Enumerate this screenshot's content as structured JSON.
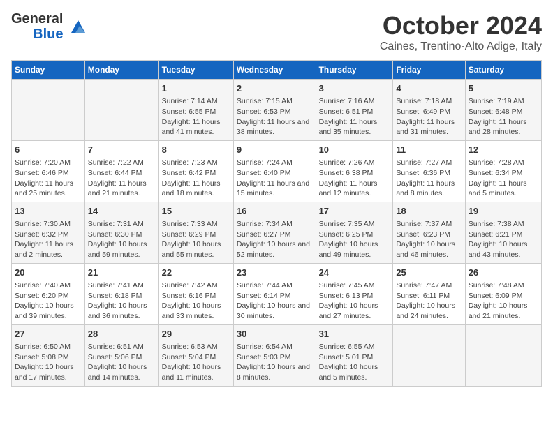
{
  "header": {
    "logo_general": "General",
    "logo_blue": "Blue",
    "month": "October 2024",
    "location": "Caines, Trentino-Alto Adige, Italy"
  },
  "days_of_week": [
    "Sunday",
    "Monday",
    "Tuesday",
    "Wednesday",
    "Thursday",
    "Friday",
    "Saturday"
  ],
  "weeks": [
    [
      {
        "day": "",
        "content": ""
      },
      {
        "day": "",
        "content": ""
      },
      {
        "day": "1",
        "content": "Sunrise: 7:14 AM\nSunset: 6:55 PM\nDaylight: 11 hours and 41 minutes."
      },
      {
        "day": "2",
        "content": "Sunrise: 7:15 AM\nSunset: 6:53 PM\nDaylight: 11 hours and 38 minutes."
      },
      {
        "day": "3",
        "content": "Sunrise: 7:16 AM\nSunset: 6:51 PM\nDaylight: 11 hours and 35 minutes."
      },
      {
        "day": "4",
        "content": "Sunrise: 7:18 AM\nSunset: 6:49 PM\nDaylight: 11 hours and 31 minutes."
      },
      {
        "day": "5",
        "content": "Sunrise: 7:19 AM\nSunset: 6:48 PM\nDaylight: 11 hours and 28 minutes."
      }
    ],
    [
      {
        "day": "6",
        "content": "Sunrise: 7:20 AM\nSunset: 6:46 PM\nDaylight: 11 hours and 25 minutes."
      },
      {
        "day": "7",
        "content": "Sunrise: 7:22 AM\nSunset: 6:44 PM\nDaylight: 11 hours and 21 minutes."
      },
      {
        "day": "8",
        "content": "Sunrise: 7:23 AM\nSunset: 6:42 PM\nDaylight: 11 hours and 18 minutes."
      },
      {
        "day": "9",
        "content": "Sunrise: 7:24 AM\nSunset: 6:40 PM\nDaylight: 11 hours and 15 minutes."
      },
      {
        "day": "10",
        "content": "Sunrise: 7:26 AM\nSunset: 6:38 PM\nDaylight: 11 hours and 12 minutes."
      },
      {
        "day": "11",
        "content": "Sunrise: 7:27 AM\nSunset: 6:36 PM\nDaylight: 11 hours and 8 minutes."
      },
      {
        "day": "12",
        "content": "Sunrise: 7:28 AM\nSunset: 6:34 PM\nDaylight: 11 hours and 5 minutes."
      }
    ],
    [
      {
        "day": "13",
        "content": "Sunrise: 7:30 AM\nSunset: 6:32 PM\nDaylight: 11 hours and 2 minutes."
      },
      {
        "day": "14",
        "content": "Sunrise: 7:31 AM\nSunset: 6:30 PM\nDaylight: 10 hours and 59 minutes."
      },
      {
        "day": "15",
        "content": "Sunrise: 7:33 AM\nSunset: 6:29 PM\nDaylight: 10 hours and 55 minutes."
      },
      {
        "day": "16",
        "content": "Sunrise: 7:34 AM\nSunset: 6:27 PM\nDaylight: 10 hours and 52 minutes."
      },
      {
        "day": "17",
        "content": "Sunrise: 7:35 AM\nSunset: 6:25 PM\nDaylight: 10 hours and 49 minutes."
      },
      {
        "day": "18",
        "content": "Sunrise: 7:37 AM\nSunset: 6:23 PM\nDaylight: 10 hours and 46 minutes."
      },
      {
        "day": "19",
        "content": "Sunrise: 7:38 AM\nSunset: 6:21 PM\nDaylight: 10 hours and 43 minutes."
      }
    ],
    [
      {
        "day": "20",
        "content": "Sunrise: 7:40 AM\nSunset: 6:20 PM\nDaylight: 10 hours and 39 minutes."
      },
      {
        "day": "21",
        "content": "Sunrise: 7:41 AM\nSunset: 6:18 PM\nDaylight: 10 hours and 36 minutes."
      },
      {
        "day": "22",
        "content": "Sunrise: 7:42 AM\nSunset: 6:16 PM\nDaylight: 10 hours and 33 minutes."
      },
      {
        "day": "23",
        "content": "Sunrise: 7:44 AM\nSunset: 6:14 PM\nDaylight: 10 hours and 30 minutes."
      },
      {
        "day": "24",
        "content": "Sunrise: 7:45 AM\nSunset: 6:13 PM\nDaylight: 10 hours and 27 minutes."
      },
      {
        "day": "25",
        "content": "Sunrise: 7:47 AM\nSunset: 6:11 PM\nDaylight: 10 hours and 24 minutes."
      },
      {
        "day": "26",
        "content": "Sunrise: 7:48 AM\nSunset: 6:09 PM\nDaylight: 10 hours and 21 minutes."
      }
    ],
    [
      {
        "day": "27",
        "content": "Sunrise: 6:50 AM\nSunset: 5:08 PM\nDaylight: 10 hours and 17 minutes."
      },
      {
        "day": "28",
        "content": "Sunrise: 6:51 AM\nSunset: 5:06 PM\nDaylight: 10 hours and 14 minutes."
      },
      {
        "day": "29",
        "content": "Sunrise: 6:53 AM\nSunset: 5:04 PM\nDaylight: 10 hours and 11 minutes."
      },
      {
        "day": "30",
        "content": "Sunrise: 6:54 AM\nSunset: 5:03 PM\nDaylight: 10 hours and 8 minutes."
      },
      {
        "day": "31",
        "content": "Sunrise: 6:55 AM\nSunset: 5:01 PM\nDaylight: 10 hours and 5 minutes."
      },
      {
        "day": "",
        "content": ""
      },
      {
        "day": "",
        "content": ""
      }
    ]
  ]
}
